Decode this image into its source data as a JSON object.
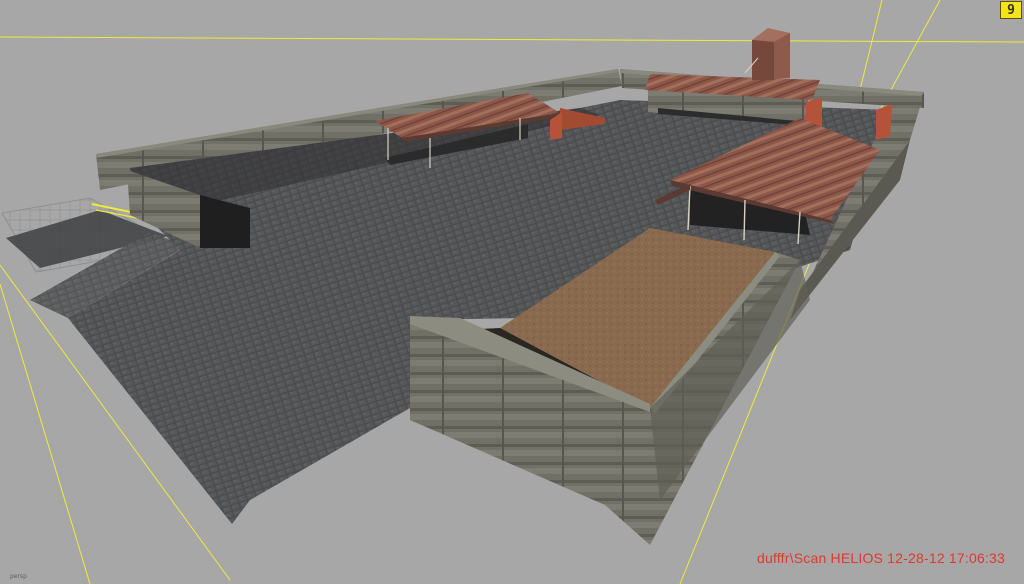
{
  "viewport": {
    "camera_label": "persp",
    "corner_badge": "9",
    "watermark": "dufffr\\Scan HELIOS 12-28-12 17:06:33"
  },
  "colors": {
    "background": "#a7a7a7",
    "grid_line": "#f0ea3a",
    "watermark": "#e0392b",
    "cobblestone": "#4a4b4d",
    "wall_stone": "#6f6e64",
    "roof_rust": "#8b5347",
    "dirt": "#8a6a4f"
  },
  "scene_objects": [
    "cobblestone-yard",
    "stone-walls",
    "rusted-roof-shed-left",
    "rusted-roof-shed-back",
    "rusted-roof-shed-right",
    "chimney-tower",
    "dirt-pen",
    "brick-pillars",
    "loading-ramp"
  ]
}
